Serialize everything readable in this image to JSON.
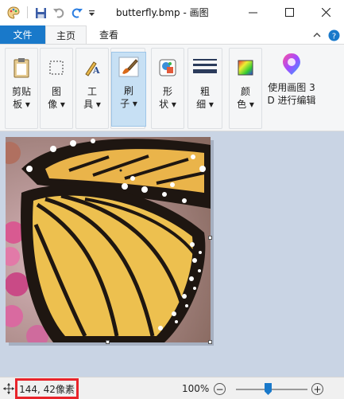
{
  "window": {
    "title": "butterfly.bmp - 画图",
    "minimize": "—",
    "maximize": "☐",
    "close": "✕"
  },
  "tabs": {
    "file": "文件",
    "home": "主页",
    "view": "查看"
  },
  "ribbon": {
    "clipboard": "剪贴\n板 ▾",
    "image": "图\n像 ▾",
    "tools": "工\n具 ▾",
    "brushes": "刷\n子 ▾",
    "shapes": "形\n状 ▾",
    "size": "粗\n细 ▾",
    "colors": "颜\n色 ▾",
    "paint3d": "使用画图 3\nD 进行编辑"
  },
  "status": {
    "cursor_position": "144, 42像素",
    "zoom": "100%",
    "zoom_minus": "−",
    "zoom_plus": "+"
  },
  "colors": {
    "file_tab": "#1979ca",
    "highlight": "#e8242b",
    "workspace": "#c9d4e4"
  }
}
